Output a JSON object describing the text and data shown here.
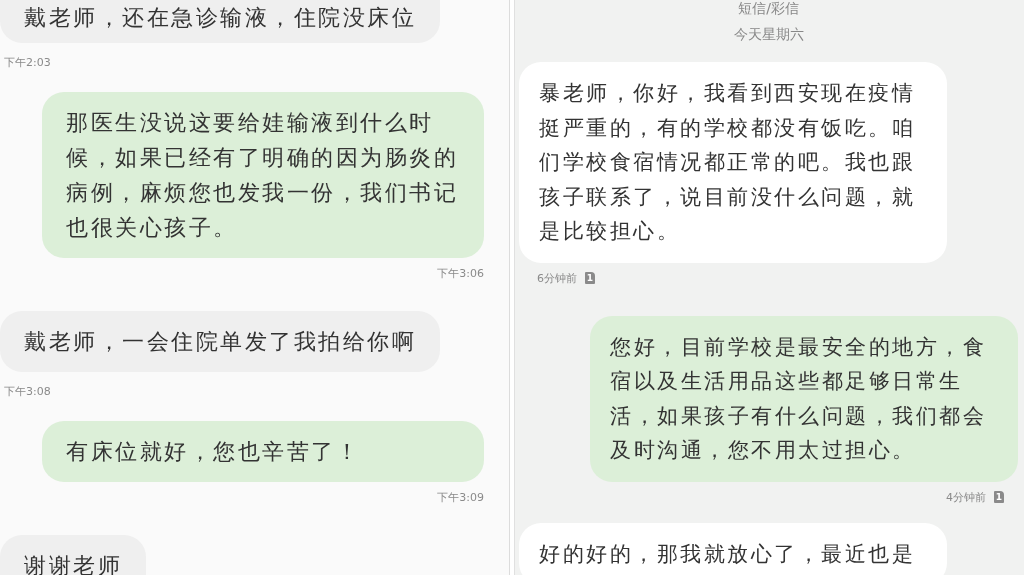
{
  "left_chat": {
    "messages": [
      {
        "kind": "in",
        "text": "戴老师，还在急诊输液，住院没床位",
        "time": "下午2:03"
      },
      {
        "kind": "out",
        "text": "那医生没说这要给娃输液到什么时候，如果已经有了明确的因为肠炎的病例，麻烦您也发我一份，我们书记也很关心孩子。",
        "time": "下午3:06"
      },
      {
        "kind": "in",
        "text": "戴老师，一会住院单发了我拍给你啊",
        "time": "下午3:08"
      },
      {
        "kind": "out",
        "text": "有床位就好，您也辛苦了！",
        "time": "下午3:09"
      },
      {
        "kind": "in",
        "text": "谢谢老师"
      }
    ]
  },
  "right_chat": {
    "header": {
      "category": "短信/彩信",
      "day": "今天星期六"
    },
    "messages": [
      {
        "kind": "in",
        "text": "暴老师，你好，我看到西安现在疫情挺严重的，有的学校都没有饭吃。咱们学校食宿情况都正常的吧。我也跟孩子联系了，说目前没什么问题，就是比较担心。",
        "time": "6分钟前",
        "sim": "1"
      },
      {
        "kind": "out",
        "text": "您好，目前学校是最安全的地方，食宿以及生活用品这些都足够日常生活，如果孩子有什么问题，我们都会及时沟通，您不用太过担心。",
        "time": "4分钟前",
        "sim": "1"
      },
      {
        "kind": "in",
        "text": "好的好的，那我就放心了，最近也是"
      }
    ]
  }
}
